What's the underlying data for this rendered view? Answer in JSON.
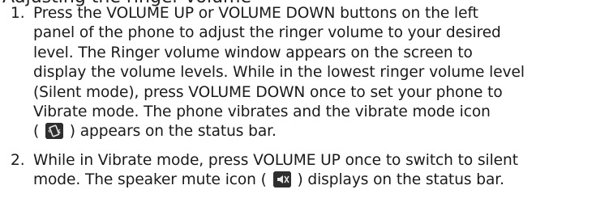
{
  "heading": "Adjusting the ringer volume",
  "steps": [
    {
      "number": "1.",
      "lines": [
        "Press the VOLUME UP or VOLUME DOWN buttons on the left",
        "panel of the phone to adjust the ringer volume to your desired",
        "level. The Ringer volume window appears on the screen to",
        "display the volume levels. While in the lowest ringer volume level",
        "(Silent mode), press VOLUME DOWN once to set your phone to",
        "Vibrate mode. The phone vibrates and the vibrate mode icon"
      ],
      "icon_line_pre": "(",
      "icon_line_post": ") appears on the status bar."
    },
    {
      "number": "2.",
      "lines": [
        "While in Vibrate mode, press VOLUME UP once to switch to silent"
      ],
      "icon_line_pre": "mode. The speaker mute icon (",
      "icon_line_post": ") displays on the status bar."
    }
  ],
  "icons": {
    "vibrate": "vibrate-mode-icon",
    "mute": "speaker-mute-icon"
  }
}
